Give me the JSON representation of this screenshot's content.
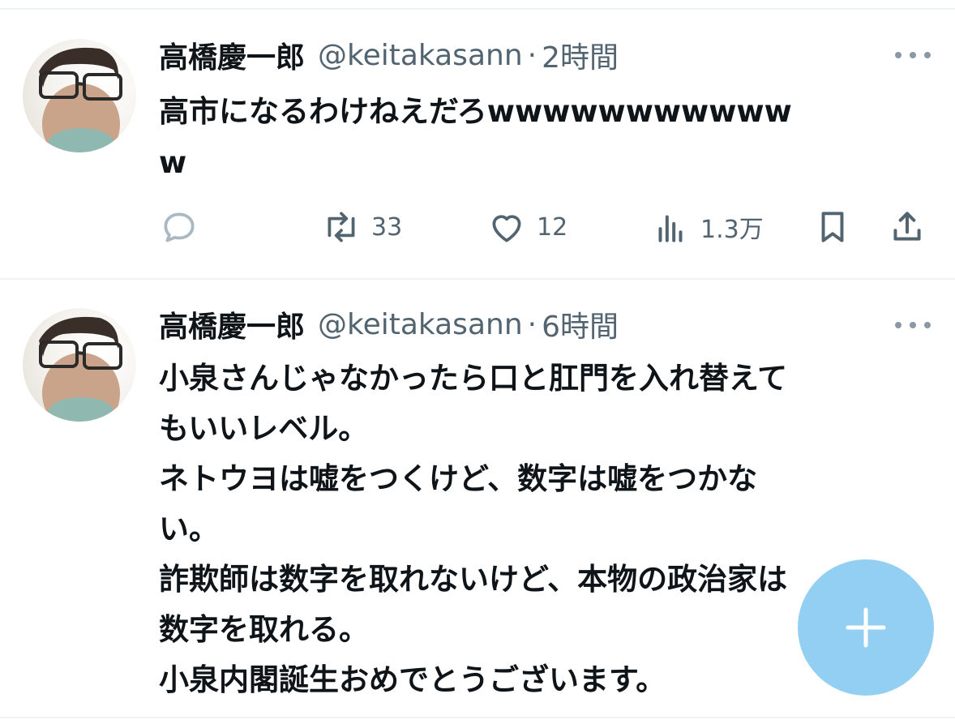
{
  "tweets": [
    {
      "author_name": "高橋慶一郎",
      "handle": "@keitakasann",
      "separator": "·",
      "time": "2時間",
      "lines": [
        "高市になるわけねえだろwwwwwwwwwww",
        "w"
      ],
      "actions": {
        "reply_icon": "reply-icon",
        "retweet_icon": "retweet-icon",
        "retweet_count": "33",
        "like_icon": "heart-icon",
        "like_count": "12",
        "views_icon": "views-icon",
        "views_count": "1.3万",
        "bookmark_icon": "bookmark-icon",
        "share_icon": "share-icon"
      }
    },
    {
      "author_name": "高橋慶一郎",
      "handle": "@keitakasann",
      "separator": "·",
      "time": "6時間",
      "lines": [
        "小泉さんじゃなかったら口と肛門を入れ替えて",
        "もいいレベル。",
        "ネトウヨは嘘をつくけど、数字は嘘をつかな",
        "い。",
        "詐欺師は数字を取れないけど、本物の政治家は",
        "数字を取れる。",
        "小泉内閣誕生おめでとうございます。"
      ]
    }
  ],
  "fab": {
    "icon": "plus-icon",
    "color": "#78c3f0"
  },
  "colors": {
    "text": "#0f1419",
    "secondary": "#536471",
    "divider": "#eff3f4"
  }
}
